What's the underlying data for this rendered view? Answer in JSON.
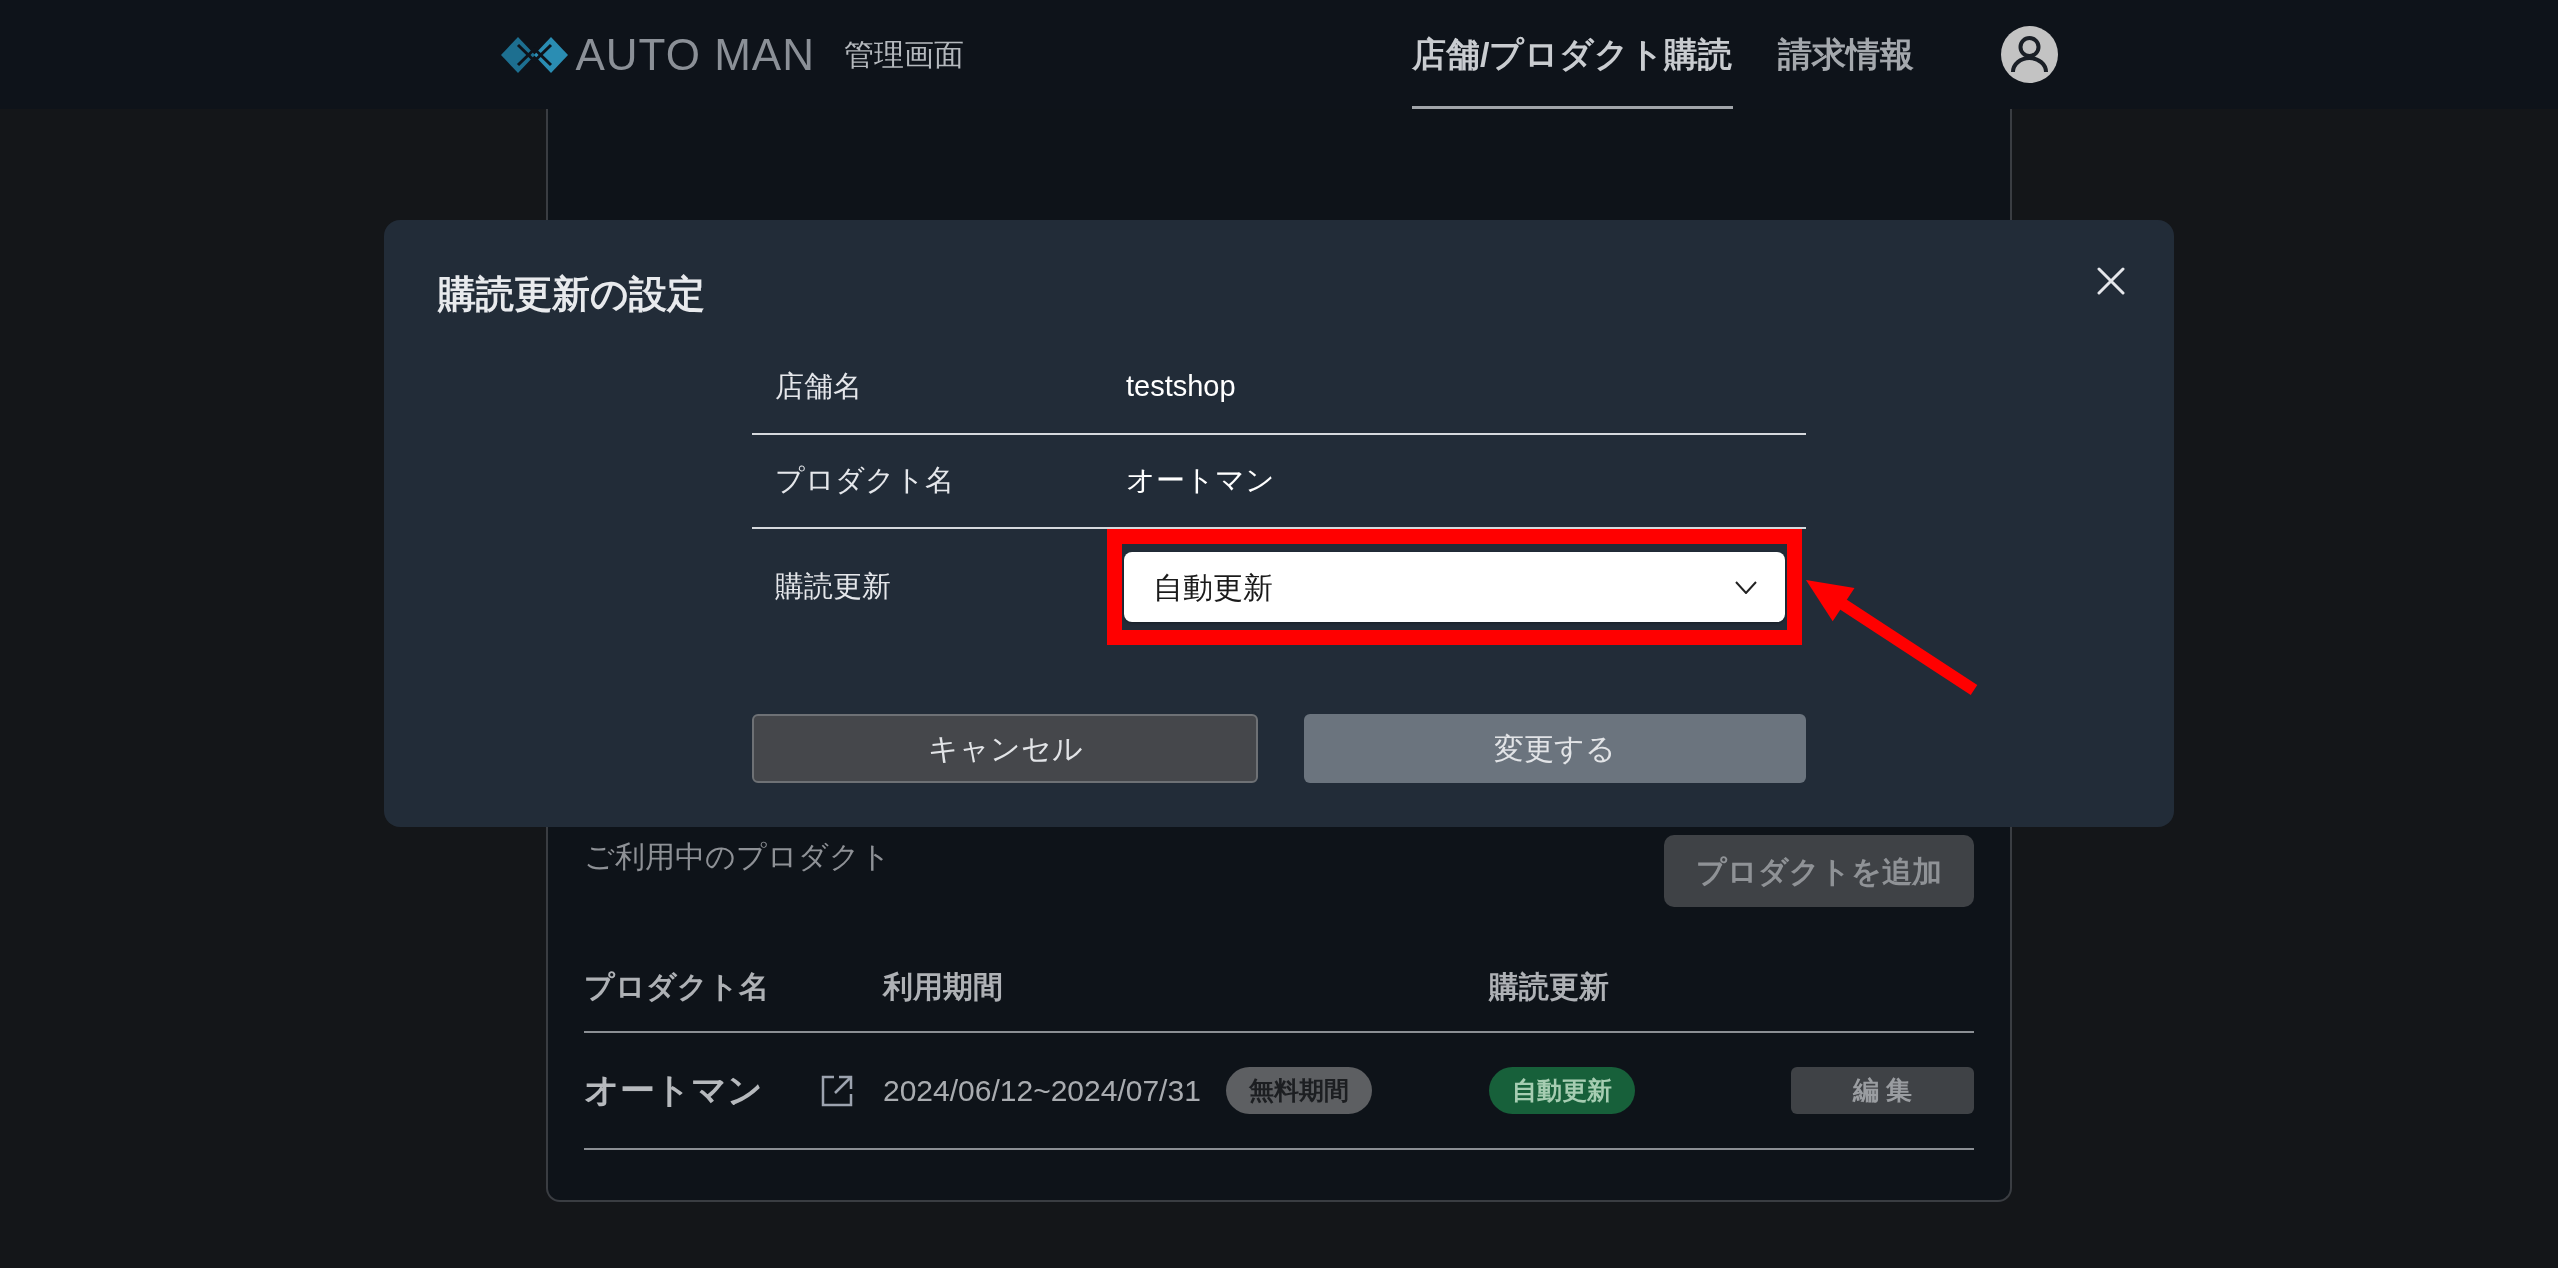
{
  "header": {
    "logo_text": "AUTO MAN",
    "subtitle": "管理画面",
    "nav": [
      {
        "label": "店舗/プロダクト購読",
        "selected": true
      },
      {
        "label": "請求情報",
        "selected": false
      }
    ]
  },
  "dialog": {
    "title": "購読更新の設定",
    "fields": [
      {
        "kind": "text",
        "label": "店舗名",
        "value": "testshop"
      },
      {
        "kind": "text",
        "label": "プロダクト名",
        "value": "オートマン"
      },
      {
        "kind": "select",
        "label": "購読更新",
        "value": "自動更新",
        "highlighted": true
      }
    ],
    "buttons": [
      {
        "kind": "secondary",
        "label": "キャンセル"
      },
      {
        "kind": "primary",
        "label": "変更する"
      }
    ]
  },
  "products_panel": {
    "title": "ご利用中のプロダクト",
    "add_button": "プロダクトを追加",
    "columns": [
      "プロダクト名",
      "利用期間",
      "購読更新"
    ],
    "rows": [
      {
        "name": "オートマン",
        "period": "2024/06/12~2024/07/31",
        "period_badge": "無料期間",
        "renewal": "自動更新",
        "edit_button": "編 集"
      }
    ]
  }
}
